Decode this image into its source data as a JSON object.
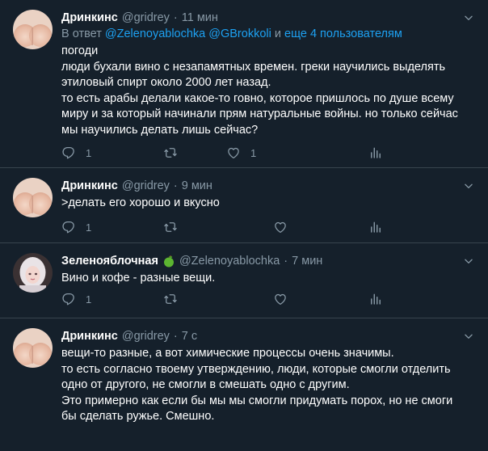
{
  "tweets": [
    {
      "name": "Дринкинс",
      "handle": "@gridrey",
      "dot": "·",
      "time": "11 мин",
      "reply_prefix": "В ответ",
      "reply_links": "@Zelenoyablochka @GBrokkoli",
      "reply_and": "и",
      "reply_more": "еще 4 пользователям",
      "lines": [
        "погоди",
        "люди бухали вино с незапамятных времен. греки научились выделять",
        "этиловый спирт около 2000 лет назад.",
        "то есть арабы делали какое-то говно, которое пришлось по душе всему",
        "миру и за который начинали прям натуральные войны. но только сейчас",
        "мы научились делать лишь сейчас?"
      ],
      "reply_count": "1",
      "retweet_count": "",
      "like_count": "1"
    },
    {
      "name": "Дринкинс",
      "handle": "@gridrey",
      "dot": "·",
      "time": "9 мин",
      "lines": [
        ">делать его хорошо и вкусно"
      ],
      "reply_count": "1",
      "retweet_count": "",
      "like_count": ""
    },
    {
      "name": "Зеленояблочная",
      "handle": "@Zelenoyablochka",
      "dot": "·",
      "time": "7 мин",
      "lines": [
        "Вино и кофе - разные вещи."
      ],
      "reply_count": "1",
      "retweet_count": "",
      "like_count": ""
    },
    {
      "name": "Дринкинс",
      "handle": "@gridrey",
      "dot": "·",
      "time": "7 с",
      "lines": [
        "вещи-то разные, а вот химические процессы очень значимы.",
        "то есть согласно твоему утверждению, люди, которые смогли отделить",
        "одно от другого, не смогли в смешать одно с другим.",
        "Это примерно как если бы мы мы смогли придумать порох, но не смоги",
        "бы сделать ружье. Смешно."
      ]
    }
  ],
  "icons": {
    "reply": "reply-icon",
    "retweet": "retweet-icon",
    "like": "like-icon",
    "analytics": "analytics-icon",
    "more": "chevron-down-icon",
    "apple": "green-apple-emoji"
  },
  "colors": {
    "background": "#15202b",
    "text": "#ffffff",
    "secondary": "#8899a6",
    "link": "#1da1f2",
    "divider": "#38444d",
    "apple": "#5cb531"
  }
}
